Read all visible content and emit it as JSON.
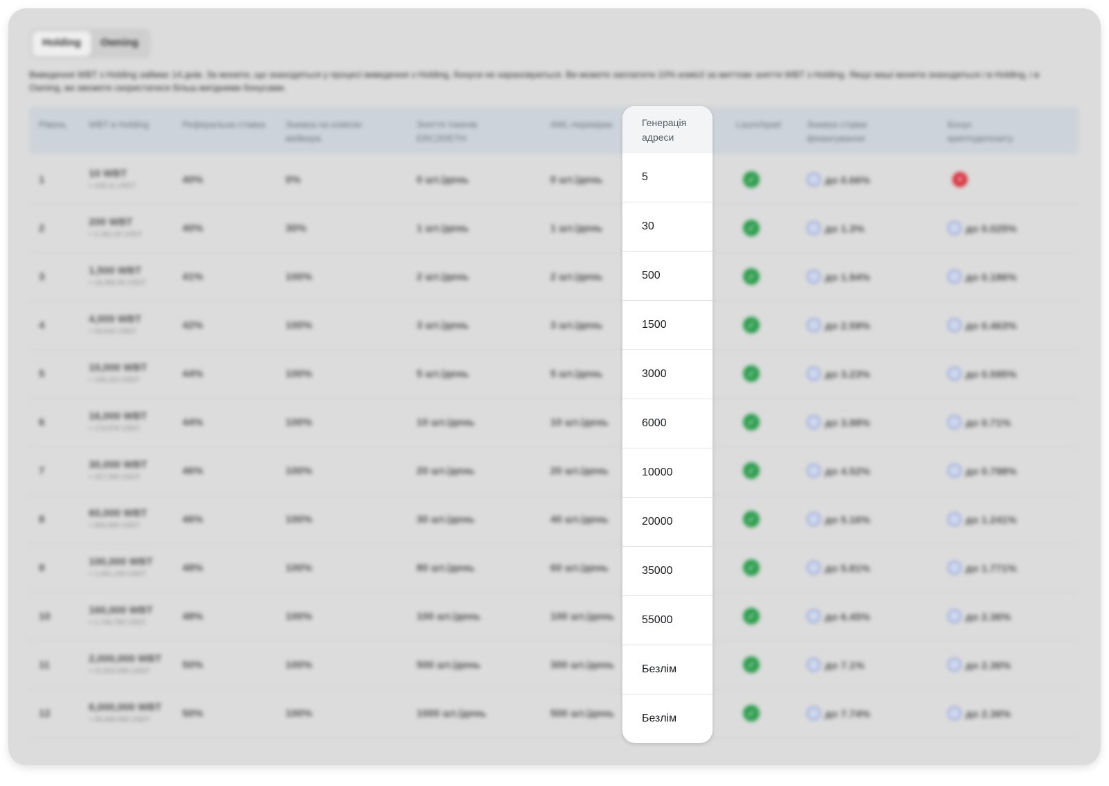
{
  "tabs": [
    "Holding",
    "Owning"
  ],
  "active_tab": 0,
  "description": "Виведення WBT з Holding займає 14 днів. За монети, що знаходяться у процесі виведення з Holding, бонуси не нараховуються. Ви можете заплатити 10% комісії за миттєве зняття WBT з Holding. Якщо ваші монети знаходяться і в Holding, і в Owning, ви зможете скористатися більш вигідними бонусами.",
  "columns": [
    "Рівень",
    "WBT в Holding",
    "Реферальна ставка",
    "Знижка на комісію мейкера",
    "Зняття токенів ERC20/ETH",
    "AML-перевірки",
    "Генерація адреси",
    "Launchpad",
    "Знижка ставки фінансування",
    "Бонус криптодепозиту"
  ],
  "highlight_header_lines": [
    "Генерація",
    "адреси"
  ],
  "rows": [
    {
      "level": "1",
      "holding": "10 WBT",
      "holding_sub": "≈ 109.11 USDT",
      "ref": "40%",
      "maker": "0%",
      "withdraw": "0 шт./день",
      "aml": "0 шт./день",
      "address": "5",
      "launchpad": true,
      "funding": "до 0.66%",
      "bonus": null
    },
    {
      "level": "2",
      "holding": "200 WBT",
      "holding_sub": "≈ 2,182.20 USDT",
      "ref": "40%",
      "maker": "30%",
      "withdraw": "1 шт./день",
      "aml": "1 шт./день",
      "address": "30",
      "launchpad": true,
      "funding": "до 1.3%",
      "bonus": "до 0.025%"
    },
    {
      "level": "3",
      "holding": "1,500 WBT",
      "holding_sub": "≈ 16,366.50 USDT",
      "ref": "41%",
      "maker": "100%",
      "withdraw": "2 шт./день",
      "aml": "2 шт./день",
      "address": "500",
      "launchpad": true,
      "funding": "до 1.94%",
      "bonus": "до 0.186%"
    },
    {
      "level": "4",
      "holding": "4,000 WBT",
      "holding_sub": "≈ 43,644 USDT",
      "ref": "42%",
      "maker": "100%",
      "withdraw": "3 шт./день",
      "aml": "3 шт./день",
      "address": "1500",
      "launchpad": true,
      "funding": "до 2.59%",
      "bonus": "до 0.463%"
    },
    {
      "level": "5",
      "holding": "10,000 WBT",
      "holding_sub": "≈ 109,110 USDT",
      "ref": "44%",
      "maker": "100%",
      "withdraw": "5 шт./день",
      "aml": "5 шт./день",
      "address": "3000",
      "launchpad": true,
      "funding": "до 3.23%",
      "bonus": "до 0.595%"
    },
    {
      "level": "6",
      "holding": "16,000 WBT",
      "holding_sub": "≈ 174,576 USDT",
      "ref": "44%",
      "maker": "100%",
      "withdraw": "10 шт./день",
      "aml": "10 шт./день",
      "address": "6000",
      "launchpad": true,
      "funding": "до 3.88%",
      "bonus": "до 0.71%"
    },
    {
      "level": "7",
      "holding": "30,000 WBT",
      "holding_sub": "≈ 327,330 USDT",
      "ref": "46%",
      "maker": "100%",
      "withdraw": "20 шт./день",
      "aml": "20 шт./день",
      "address": "10000",
      "launchpad": true,
      "funding": "до 4.52%",
      "bonus": "до 0.798%"
    },
    {
      "level": "8",
      "holding": "60,000 WBT",
      "holding_sub": "≈ 654,660 USDT",
      "ref": "46%",
      "maker": "100%",
      "withdraw": "30 шт./день",
      "aml": "40 шт./день",
      "address": "20000",
      "launchpad": true,
      "funding": "до 5.16%",
      "bonus": "до 1.241%"
    },
    {
      "level": "9",
      "holding": "100,000 WBT",
      "holding_sub": "≈ 1,091,100 USDT",
      "ref": "48%",
      "maker": "100%",
      "withdraw": "80 шт./день",
      "aml": "60 шт./день",
      "address": "35000",
      "launchpad": true,
      "funding": "до 5.81%",
      "bonus": "до 1.771%"
    },
    {
      "level": "10",
      "holding": "160,000 WBT",
      "holding_sub": "≈ 1,745,760 USDT",
      "ref": "48%",
      "maker": "100%",
      "withdraw": "100 шт./день",
      "aml": "100 шт./день",
      "address": "55000",
      "launchpad": true,
      "funding": "до 6.45%",
      "bonus": "до 2.36%"
    },
    {
      "level": "11",
      "holding": "2,000,000 WBT",
      "holding_sub": "≈ 21,822,000 USDT",
      "ref": "50%",
      "maker": "100%",
      "withdraw": "500 шт./день",
      "aml": "300 шт./день",
      "address": "Безлім",
      "launchpad": true,
      "funding": "до 7.1%",
      "bonus": "до 2.36%"
    },
    {
      "level": "12",
      "holding": "6,000,000 WBT",
      "holding_sub": "≈ 65,466,000 USDT",
      "ref": "50%",
      "maker": "100%",
      "withdraw": "1000 шт./день",
      "aml": "500 шт./день",
      "address": "Безлім",
      "launchpad": true,
      "funding": "до 7.74%",
      "bonus": "до 2.36%"
    }
  ],
  "icons": {
    "check": "check-circle-icon",
    "cross": "cross-circle-icon",
    "coin": "coin-icon"
  },
  "colors": {
    "check": "#2e9e4f",
    "cross": "#d9333f",
    "highlight_bg": "#ffffff",
    "card_bg": "#dcdcdc"
  }
}
